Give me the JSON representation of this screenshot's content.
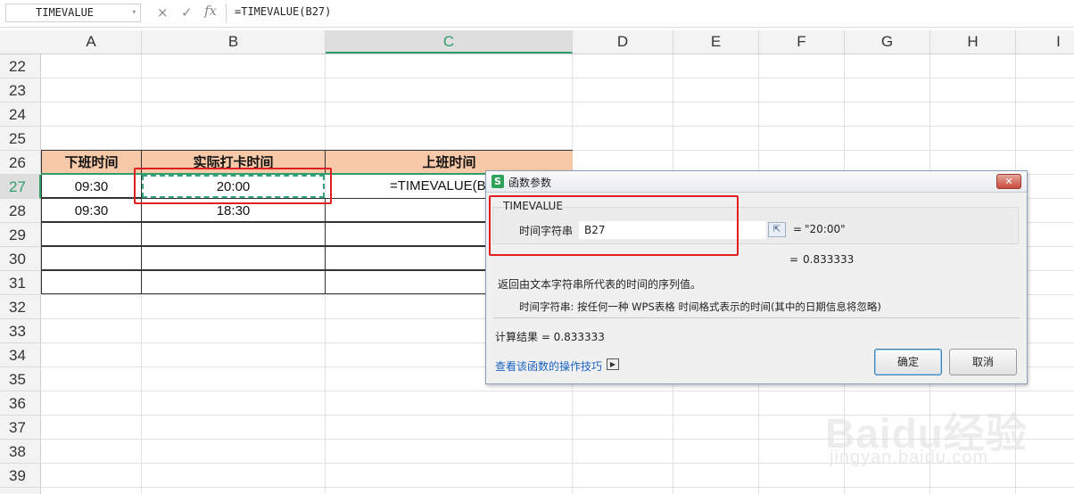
{
  "formula_bar": {
    "name_box": "TIMEVALUE",
    "cancel_icon": "×",
    "enter_icon": "✓",
    "fx_label": "fx",
    "formula": "=TIMEVALUE(B27)"
  },
  "columns": [
    "A",
    "B",
    "C",
    "D",
    "E",
    "F",
    "G",
    "H",
    "I"
  ],
  "selected_column": "C",
  "rows": [
    "22",
    "23",
    "24",
    "25",
    "26",
    "27",
    "28",
    "29",
    "30",
    "31",
    "32",
    "33",
    "34",
    "35",
    "36",
    "37",
    "38",
    "39"
  ],
  "selected_row": "27",
  "table": {
    "headers": [
      "下班时间",
      "实际打卡时间",
      "上班时间"
    ],
    "row27": {
      "a": "09:30",
      "b": "20:00",
      "c": "=TIMEVALUE(B"
    },
    "row28": {
      "a": "09:30",
      "b": "18:30"
    }
  },
  "dialog": {
    "title": "函数参数",
    "logo": "S",
    "close": "✕",
    "function_name": "TIMEVALUE",
    "arg_label": "时间字符串",
    "arg_value": "B27",
    "arg_eq": "=",
    "arg_result": "\"20:00\"",
    "result_eq": "=",
    "result": "0.833333",
    "description": "返回由文本字符串所代表的时间的序列值。",
    "arg_description": "时间字符串:  按任何一种 WPS表格 时间格式表示的时间(其中的日期信息将忽略)",
    "calc_result": "计算结果 =  0.833333",
    "help_link": "查看该函数的操作技巧",
    "ok": "确定",
    "cancel": "取消"
  },
  "watermark": {
    "text": "Baidu经验",
    "sub": "jingyan.baidu.com"
  }
}
